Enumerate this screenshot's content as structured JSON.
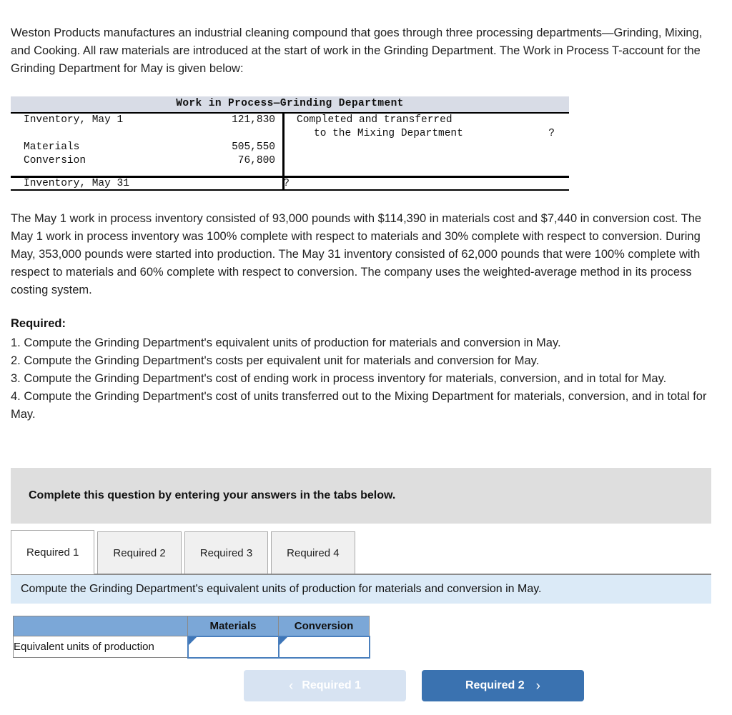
{
  "intro": {
    "paragraph": "Weston Products manufactures an industrial cleaning compound that goes through three processing departments—Grinding, Mixing, and Cooking. All raw materials are introduced at the start of work in the Grinding Department. The Work in Process T-account for the Grinding Department for May is given below:"
  },
  "taccount": {
    "title": "Work in Process—Grinding Department",
    "left_rows": [
      {
        "label": "Inventory, May 1",
        "amount": "121,830"
      },
      {
        "label": "",
        "amount": ""
      },
      {
        "label": "Materials",
        "amount": "505,550"
      },
      {
        "label": "Conversion",
        "amount": "76,800"
      }
    ],
    "right_rows": [
      {
        "label": "Completed and transferred",
        "amount": ""
      },
      {
        "label": "to the Mixing Department",
        "amount": "?"
      }
    ],
    "footer": {
      "label": "Inventory, May 31",
      "amount": "?"
    }
  },
  "facts": {
    "paragraph": "The May 1 work in process inventory consisted of 93,000 pounds with $114,390 in materials cost and $7,440 in conversion cost. The May 1 work in process inventory was 100% complete with respect to materials and 30% complete with respect to conversion. During May, 353,000 pounds were started into production. The May 31 inventory consisted of 62,000 pounds that were 100% complete with respect to materials and 60% complete with respect to conversion. The company uses the weighted-average method in its process costing system."
  },
  "required": {
    "heading": "Required:",
    "items": [
      "1. Compute the Grinding Department's equivalent units of production for materials and conversion in May.",
      "2. Compute the Grinding Department's costs per equivalent unit for materials and conversion for May.",
      "3. Compute the Grinding Department's cost of ending work in process inventory for materials, conversion, and in total for May.",
      "4. Compute the Grinding Department's cost of units transferred out to the Mixing Department for materials, conversion, and in total for May."
    ]
  },
  "banner": {
    "text": "Complete this question by entering your answers in the tabs below."
  },
  "tabs": [
    {
      "label": "Required 1",
      "active": true
    },
    {
      "label": "Required 2",
      "active": false
    },
    {
      "label": "Required 3",
      "active": false
    },
    {
      "label": "Required 4",
      "active": false
    }
  ],
  "tab_instruction": {
    "text": "Compute the Grinding Department's equivalent units of production for materials and conversion in May."
  },
  "answer_table": {
    "headers": [
      "",
      "Materials",
      "Conversion"
    ],
    "rows": [
      {
        "label": "Equivalent units of production",
        "materials": "",
        "conversion": ""
      }
    ]
  },
  "nav": {
    "prev_label": "Required 1",
    "next_label": "Required 2",
    "prev_chevron": "‹",
    "next_chevron": "›"
  },
  "colors": {
    "banner_gray": "#dedede",
    "instruction_blue": "#dbeaf7",
    "table_header_blue": "#7ba7d7",
    "next_button_blue": "#3a72b0",
    "prev_button_blue": "#d7e3f2",
    "taccount_header": "#d8dce6"
  }
}
